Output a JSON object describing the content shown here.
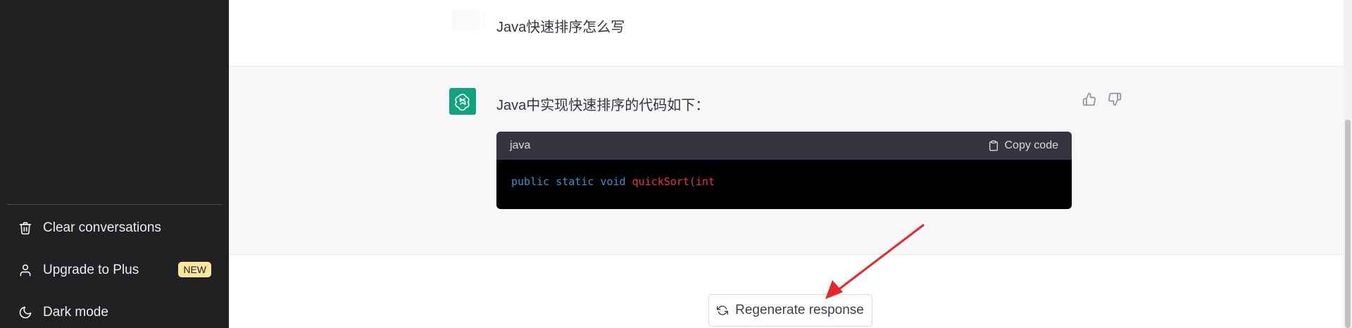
{
  "sidebar": {
    "items": [
      {
        "label": "Clear conversations",
        "icon": "trash-icon"
      },
      {
        "label": "Upgrade to Plus",
        "icon": "user-icon",
        "badge": "NEW"
      },
      {
        "label": "Dark mode",
        "icon": "moon-icon"
      }
    ]
  },
  "conversation": {
    "user_message": "Java快速排序怎么写",
    "assistant_intro": "Java中实现快速排序的代码如下：",
    "code": {
      "language": "java",
      "copy_label": "Copy code",
      "tokens": [
        "public",
        "static",
        "void",
        "quickSort",
        "(",
        "int"
      ]
    }
  },
  "actions": {
    "regenerate_label": "Regenerate response"
  },
  "colors": {
    "sidebar_bg": "#202123",
    "accent": "#10a37f",
    "badge_bg": "#fae69e",
    "annotation_arrow": "#e8262b"
  }
}
